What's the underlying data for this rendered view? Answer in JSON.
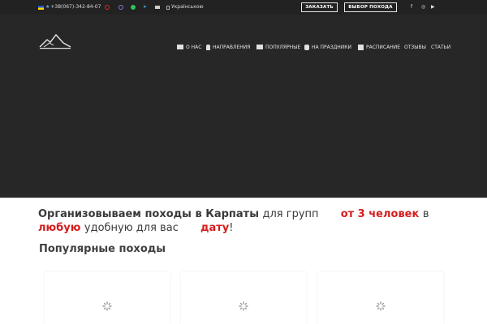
{
  "topbar": {
    "phone": "+38(067)-342-84-07",
    "language": "Українською",
    "order_button": "ЗАКАЗАТЬ",
    "choose_button": "ВЫБОР ПОХОДА"
  },
  "nav": {
    "items": [
      {
        "label": "О НАС",
        "icon": "folder-icon"
      },
      {
        "label": "НАПРАВЛЕНИЯ",
        "icon": "map-marker-icon"
      },
      {
        "label": "ПОПУЛЯРНЫЕ",
        "icon": "list-icon"
      },
      {
        "label": "НА ПРАЗДНИКИ",
        "icon": "stack-icon"
      },
      {
        "label": "РАСПИСАНИЕ",
        "icon": "calendar-icon"
      },
      {
        "label": "ОТЗЫВЫ",
        "icon": ""
      },
      {
        "label": "СТАТЬИ",
        "icon": ""
      }
    ]
  },
  "headline": {
    "part1": "Организовываем походы в Карпаты",
    "part2": "для групп",
    "highlight1": "от 3 человек",
    "part3": "в",
    "highlight2": "любую",
    "part4": "удобную для вас",
    "highlight3": "дату",
    "part5": "!"
  },
  "section": {
    "title": "Популярные походы"
  },
  "colors": {
    "topbar_bg": "#222222",
    "hero_bg": "#272727",
    "accent_red": "#d41d1d"
  }
}
